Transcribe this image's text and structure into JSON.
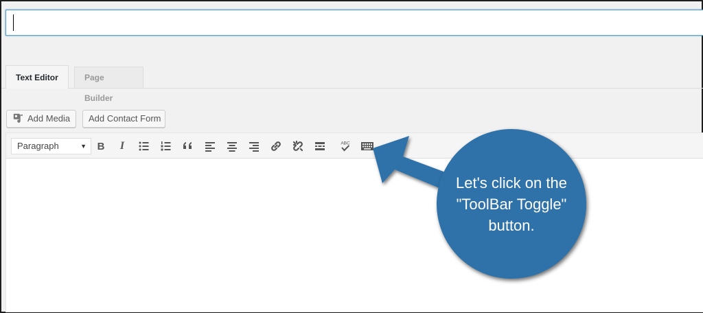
{
  "title_input": {
    "value": "",
    "placeholder": ""
  },
  "tabs": [
    {
      "label": "Text Editor",
      "active": true
    },
    {
      "label": "Page Builder",
      "active": false
    }
  ],
  "media_buttons": {
    "add_media": "Add Media",
    "add_contact_form": "Add Contact Form"
  },
  "toolbar": {
    "format_select": "Paragraph",
    "buttons": [
      "bold-icon",
      "italic-icon",
      "bulleted-list-icon",
      "numbered-list-icon",
      "blockquote-icon",
      "align-left-icon",
      "align-center-icon",
      "align-right-icon",
      "link-icon",
      "unlink-icon",
      "read-more-icon",
      "spellcheck-icon",
      "toolbar-toggle-icon"
    ],
    "bold_glyph": "B",
    "italic_glyph": "I",
    "spellcheck_text": "ABC"
  },
  "callout": {
    "text": "Let's click on the \"ToolBar Toggle\" button.",
    "color": "#2e72a9"
  },
  "colors": {
    "focus_border": "#5b9dd9",
    "icon": "#555555",
    "background": "#f1f1f1"
  }
}
